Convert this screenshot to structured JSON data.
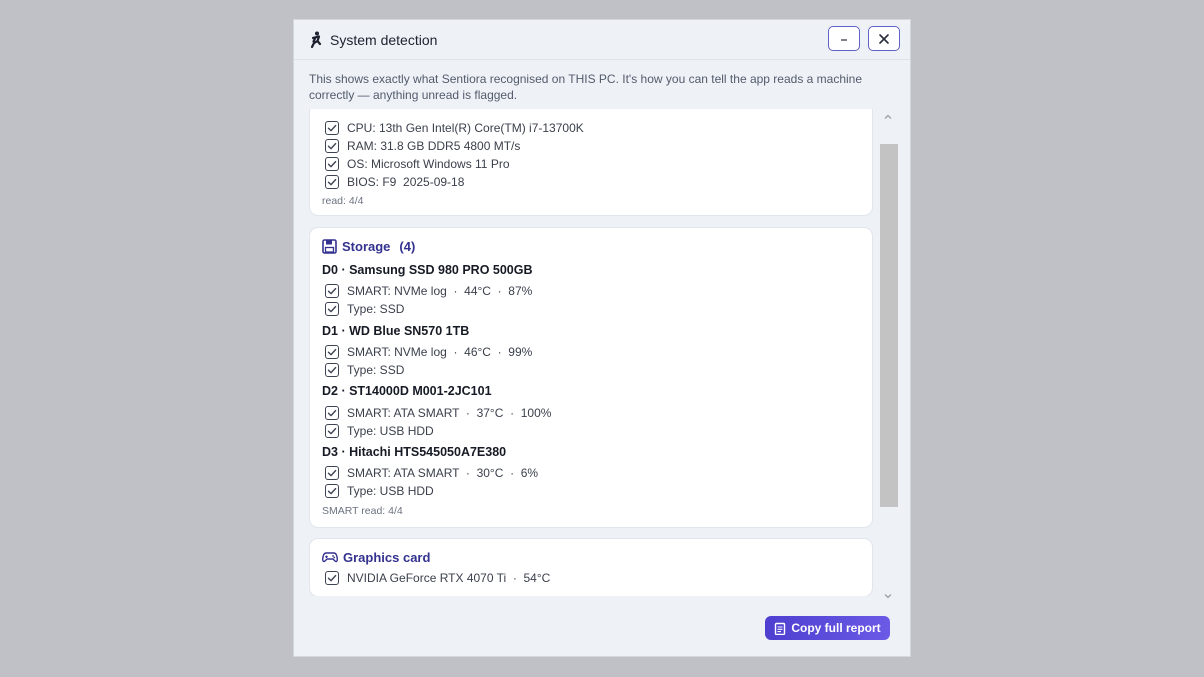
{
  "window": {
    "title": "System detection",
    "subtitle": "This shows exactly what Sentiora recognised on THIS PC. It's how you can tell the app reads a machine correctly — anything unread is flagged."
  },
  "system_card": {
    "rows": [
      "CPU: 13th Gen Intel(R) Core(TM) i7-13700K",
      "RAM: 31.8 GB DDR5 4800 MT/s",
      "OS: Microsoft Windows 11 Pro",
      "BIOS: F9  2025-09-18"
    ],
    "footnote": "read: 4/4"
  },
  "storage_card": {
    "title": "Storage",
    "count": "(4)",
    "drives": [
      {
        "name": "D0 · Samsung SSD 980 PRO 500GB",
        "smart": "SMART: NVMe log  ·  44°C  ·  87%",
        "type": "Type: SSD"
      },
      {
        "name": "D1 · WD Blue SN570 1TB",
        "smart": "SMART: NVMe log  ·  46°C  ·  99%",
        "type": "Type: SSD"
      },
      {
        "name": "D2 · ST14000D M001-2JC101",
        "smart": "SMART: ATA SMART  ·  37°C  ·  100%",
        "type": "Type: USB HDD"
      },
      {
        "name": "D3 · Hitachi HTS545050A7E380",
        "smart": "SMART: ATA SMART  ·  30°C  ·  6%",
        "type": "Type: USB HDD"
      }
    ],
    "footnote": "SMART read: 4/4"
  },
  "gpu_card": {
    "title": "Graphics card",
    "rows": [
      "NVIDIA GeForce RTX 4070 Ti  ·  54°C"
    ]
  },
  "copy_button": {
    "label": "Copy full report"
  },
  "icons": {
    "app": "runner-icon",
    "storage": "floppy-disk-icon",
    "gpu": "gamepad-icon",
    "copy": "clipboard-icon",
    "check": "checkbox-checked-icon"
  },
  "colors": {
    "accent": "#5b4fd9",
    "heading": "#34328f"
  }
}
